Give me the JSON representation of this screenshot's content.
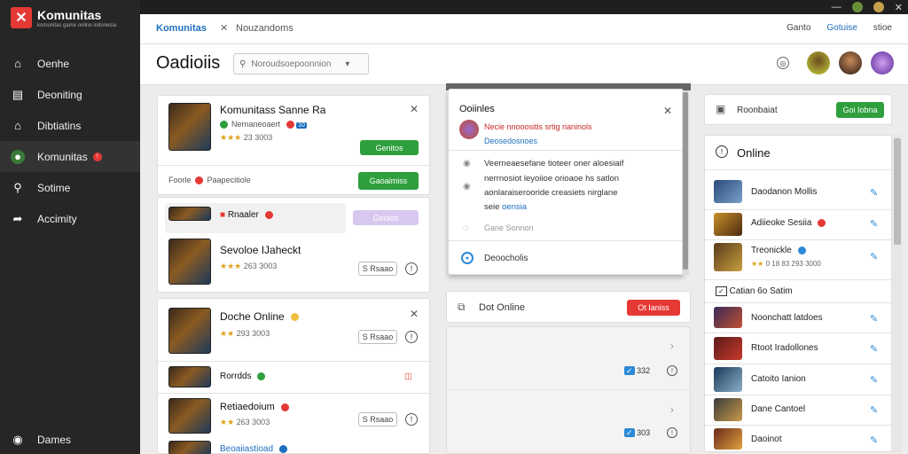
{
  "colors": {
    "accent": "#1e6fbf",
    "green": "#2e9f3c",
    "red": "#e53935"
  },
  "brand": {
    "name": "Komunitas",
    "subtitle": "komunitas game online indonesia"
  },
  "sidebar": {
    "items": [
      {
        "label": "Oenhe",
        "icon": "home-icon"
      },
      {
        "label": "Deoniting",
        "icon": "inbox-icon"
      },
      {
        "label": "Dibtiatins",
        "icon": "store-icon"
      },
      {
        "label": "Komunitas",
        "icon": "community-icon",
        "badge": "!"
      },
      {
        "label": "Sotime",
        "icon": "search-icon"
      },
      {
        "label": "Accimity",
        "icon": "share-icon"
      }
    ],
    "bottom": {
      "label": "Dames",
      "icon": "gamepad-icon"
    }
  },
  "topbar": {
    "crumb1": "Komunitas",
    "crumb2": "Nouzandoms",
    "right": [
      "Ganto",
      "Gotuise",
      "stioe"
    ]
  },
  "header": {
    "title": "Oadioiis",
    "search_placeholder": "Noroudsoepoonnion"
  },
  "left": {
    "card1": {
      "title": "Komunitass Sanne Ra",
      "sub": "Nernaneoaert",
      "sub_badge": "10",
      "stars": "★★★",
      "rating": "23 3003",
      "btn": "Genitos",
      "foot_label": "Foorle",
      "foot_text": "Paapecitiole",
      "foot_btn": "Gaoaimiss"
    },
    "card2": {
      "row1": "Rnaaler",
      "row1_btn": "Genios",
      "title": "Sevoloe IJaheckt",
      "stars": "★★★",
      "rating": "263 3003",
      "btn": "S Rsaao"
    },
    "card3": {
      "title": "Doche Online",
      "stars": "★★",
      "rating": "293 3003",
      "btn": "S Rsaao",
      "row1": "Rorrdds",
      "row2": "Retiaedoium",
      "row2_stars": "★★",
      "row2_rating": "263 3003",
      "row2_btn": "S Rsaao",
      "row3": "Beoaiiastioad"
    }
  },
  "mid": {
    "popup": {
      "title": "Ooiinles",
      "line1": "Necie nnooositis srtig rianinols",
      "line2": "Deosedosnoes",
      "p1": "Veerneaesefane tioteer oner aloesiaif",
      "p2": "nerrnosiot leyoiioe orioaoe hs satlon",
      "p3": "aonlaraiserooride creasiets nirglane",
      "p4": "seie",
      "p4_link": "oensia",
      "item1": "Gane Sonnon",
      "item2": "Deoocholis"
    },
    "bar": {
      "label": "Dot Online",
      "btn": "Ot Ianiss"
    },
    "rows": [
      {
        "count": "332"
      },
      {
        "count": "303"
      }
    ]
  },
  "right": {
    "top": {
      "label": "Roonbaiat",
      "btn": "Goi Iobna"
    },
    "panel": {
      "title": "Online",
      "items": [
        {
          "name": "Daodanon Mollis"
        },
        {
          "name": "Adiieoke Sesiia"
        },
        {
          "name": "Treonickle",
          "stars": "★★",
          "rating": "0 18 83 293 3000"
        },
        {
          "name": "Catian 6o Satim"
        },
        {
          "name": "Noonchatt latdoes"
        },
        {
          "name": "Rtoot Iradollones"
        },
        {
          "name": "Catoito Ianion"
        },
        {
          "name": "Dane Cantoel"
        },
        {
          "name": "Daoinot"
        }
      ]
    }
  }
}
